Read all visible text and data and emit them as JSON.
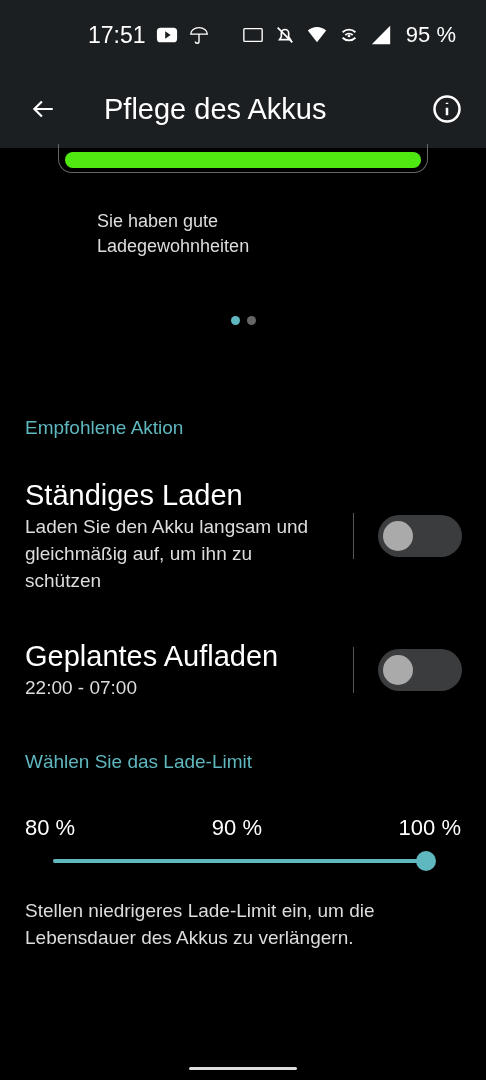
{
  "status_bar": {
    "time": "17:51",
    "battery": "95 %"
  },
  "app_bar": {
    "title": "Pflege des Akkus"
  },
  "health_card": {
    "level": 1,
    "message": "Sie haben gute Ladegewohnheiten"
  },
  "pager_dots": [
    {
      "selected": true
    },
    {
      "selected": false
    }
  ],
  "sections": [
    {
      "title": "Empfohlene Aktion",
      "kind": "toggles",
      "items": [
        {
          "title": "Ständiges Laden",
          "subtitle": "Laden Sie den Akku langsam und gleichmäßig auf, um ihn zu schützen",
          "on": false
        },
        {
          "title": "Geplantes Aufladen",
          "subtitle": "22:00 - 07:00",
          "on": false
        }
      ]
    },
    {
      "title": "Wählen Sie das Lade-Limit",
      "kind": "slider",
      "ticks": [
        "80 %",
        "90 %",
        "100 %"
      ],
      "level": 1,
      "note": "Stellen niedrigeres Lade-Limit ein, um die Lebensdauer des Akkus zu verlängern."
    }
  ]
}
